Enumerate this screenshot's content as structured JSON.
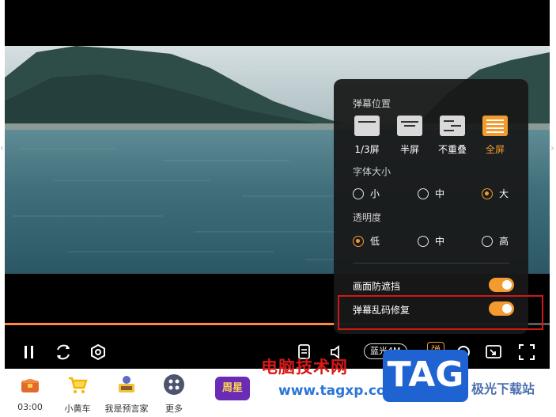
{
  "player": {
    "time": "03:00",
    "quality_label": "蓝光4M",
    "danmu_label": "弹",
    "progress_fraction": 0.61
  },
  "panel": {
    "position_title": "弹幕位置",
    "position_options": [
      {
        "label": "1/3屏",
        "active": false
      },
      {
        "label": "半屏",
        "active": false
      },
      {
        "label": "不重叠",
        "active": false
      },
      {
        "label": "全屏",
        "active": true
      }
    ],
    "font_title": "字体大小",
    "font_options": [
      {
        "label": "小",
        "checked": false
      },
      {
        "label": "中",
        "checked": false
      },
      {
        "label": "大",
        "checked": true
      }
    ],
    "opacity_title": "透明度",
    "opacity_options": [
      {
        "label": "低",
        "checked": true
      },
      {
        "label": "中",
        "checked": false
      },
      {
        "label": "高",
        "checked": false
      }
    ],
    "toggles": [
      {
        "label": "画面防遮挡",
        "on": true
      },
      {
        "label": "弹幕乱码修复",
        "on": true
      }
    ]
  },
  "toolbar": {
    "items": [
      {
        "label": "03:00",
        "icon": "treasure-chest-icon"
      },
      {
        "label": "小黄车",
        "icon": "shopping-cart-icon"
      },
      {
        "label": "我是预言家",
        "icon": "prophet-icon"
      },
      {
        "label": "更多",
        "icon": "more-grid-icon"
      }
    ],
    "badge_label": "周星"
  },
  "watermark": {
    "cn_text": "电脑技术网",
    "url": "www.tagxp.com",
    "tag": "TAG",
    "site": "极光下载站"
  },
  "colors": {
    "accent": "#f39b2f",
    "panel_bg": "#181818",
    "highlight": "#d01818"
  }
}
